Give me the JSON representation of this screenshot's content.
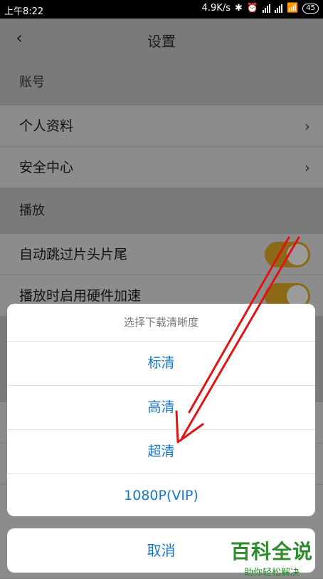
{
  "status": {
    "time": "上午8:22",
    "speed": "4.9K/s",
    "battery": "45"
  },
  "header": {
    "title": "设置"
  },
  "sections": {
    "account": "账号",
    "play": "播放"
  },
  "rows": {
    "profile": "个人资料",
    "security": "安全中心",
    "skip": "自动跳过片头片尾",
    "hw": "播放时启用硬件加速"
  },
  "sheet": {
    "title": "选择下载清晰度",
    "options": [
      "标清",
      "高清",
      "超清",
      "1080P(VIP)"
    ],
    "cancel": "取消"
  },
  "watermark": {
    "main": "百科全说",
    "sub": "助你轻松解决"
  },
  "colors": {
    "accent": "#1877c8",
    "toggle": "#e5a520",
    "arrow": "#e11414"
  }
}
